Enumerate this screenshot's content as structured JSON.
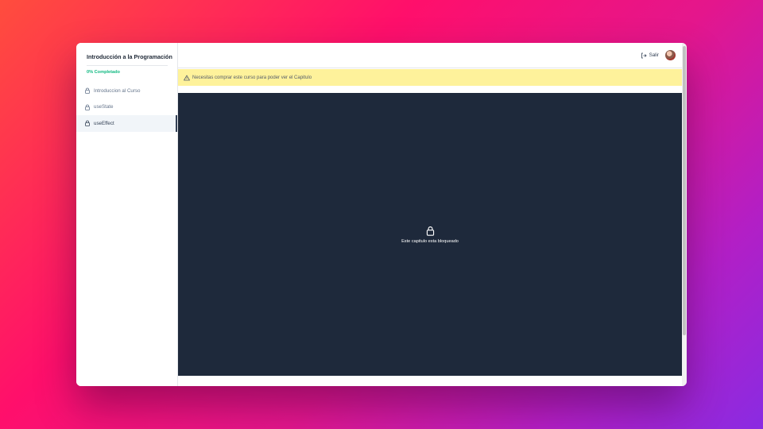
{
  "sidebar": {
    "course_title": "Introducción a la Programación",
    "progress": "0% Completado",
    "items": [
      {
        "label": "Introduccion al Curso",
        "icon": "lock-icon"
      },
      {
        "label": "useState",
        "icon": "lock-icon"
      },
      {
        "label": "useEffect",
        "icon": "lock-icon",
        "active": true
      }
    ]
  },
  "header": {
    "exit_label": "Salir",
    "exit_icon": "logout-icon"
  },
  "banner": {
    "icon": "warning-triangle-icon",
    "text": "Necesitas comprar este curso para poder ver el Capitulo"
  },
  "player": {
    "icon": "lock-icon",
    "locked_text": "Este capitulo esta bloqueado"
  },
  "colors": {
    "accent_green": "#10b981",
    "banner_yellow": "#fef08a",
    "player_bg": "#1e293b"
  }
}
